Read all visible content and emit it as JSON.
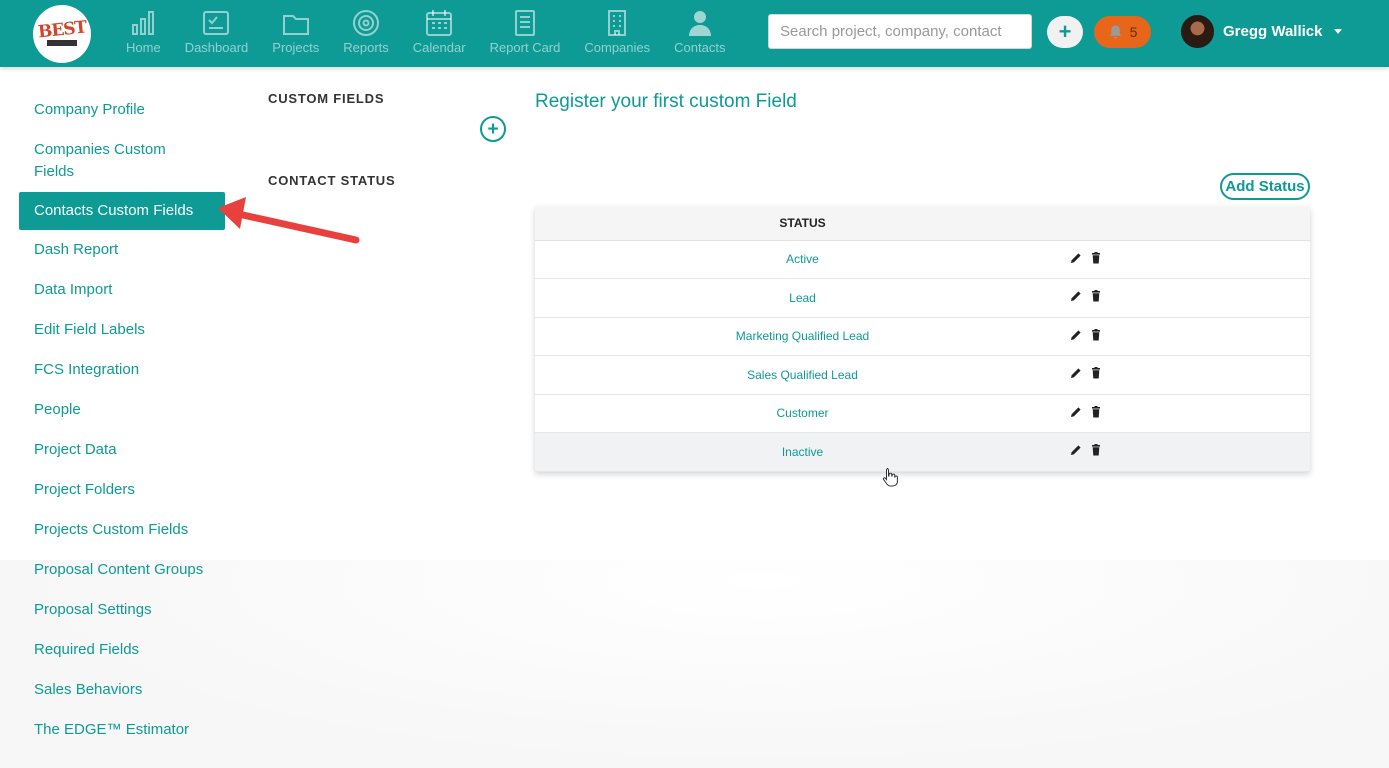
{
  "nav": {
    "items": [
      {
        "label": "Home",
        "icon": "bar-chart-icon"
      },
      {
        "label": "Dashboard",
        "icon": "dashboard-icon"
      },
      {
        "label": "Projects",
        "icon": "folder-icon"
      },
      {
        "label": "Reports",
        "icon": "target-icon"
      },
      {
        "label": "Calendar",
        "icon": "calendar-icon"
      },
      {
        "label": "Report Card",
        "icon": "report-card-icon"
      },
      {
        "label": "Companies",
        "icon": "building-icon"
      },
      {
        "label": "Contacts",
        "icon": "person-icon"
      }
    ],
    "search_placeholder": "Search project, company, contact",
    "add_label": "+",
    "notification_count": "5",
    "user_name": "Gregg Wallick",
    "logo_text": "BEST"
  },
  "sidebar": {
    "items": [
      "Company Profile",
      "Companies Custom Fields",
      "Contacts Custom Fields",
      "Dash Report",
      "Data Import",
      "Edit Field Labels",
      "FCS Integration",
      "People",
      "Project Data",
      "Project Folders",
      "Projects Custom Fields",
      "Proposal Content Groups",
      "Proposal Settings",
      "Required Fields",
      "Sales Behaviors",
      "The EDGE™ Estimator"
    ],
    "active_index": 2
  },
  "content": {
    "custom_fields_heading": "CUSTOM FIELDS",
    "contact_status_heading": "CONTACT STATUS",
    "add_field_label": "+",
    "register_title": "Register your first custom Field",
    "add_status_label": "Add Status",
    "table": {
      "header": "STATUS",
      "rows": [
        "Active",
        "Lead",
        "Marketing Qualified Lead",
        "Sales Qualified Lead",
        "Customer",
        "Inactive"
      ]
    }
  },
  "colors": {
    "brand": "#0e9a95",
    "notification": "#e8661a",
    "annotation": "#e8403c"
  }
}
